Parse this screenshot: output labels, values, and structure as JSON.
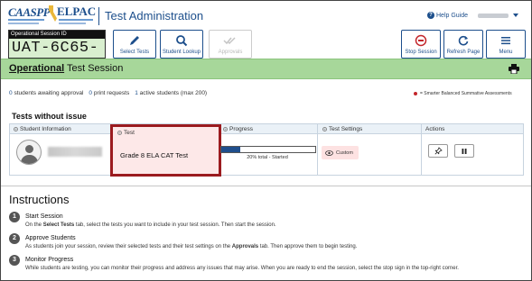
{
  "header": {
    "logo_caaspp": "CAASPP",
    "logo_elpac": "ELPAC",
    "title": "Test Administration",
    "help_label": "Help Guide"
  },
  "session": {
    "id_label": "Operational Session ID",
    "id_value": "UAT-6C65-3T"
  },
  "toolbar": {
    "select_tests": "Select Tests",
    "student_lookup": "Student Lookup",
    "approvals": "Approvals",
    "stop_session": "Stop Session",
    "refresh_page": "Refresh Page",
    "menu": "Menu"
  },
  "page_title": {
    "underlined": "Operational",
    "rest": " Test Session"
  },
  "stats": {
    "awaiting_count": "0",
    "awaiting_label": "students awaiting approval",
    "print_count": "0",
    "print_label": "print requests",
    "active_count": "1",
    "active_label": "active students (max 200)",
    "legend": "= Smarter Balanced Summative Assessments",
    "legend_color": "#c3262b"
  },
  "table": {
    "section_title": "Tests without issue",
    "columns": [
      "Student Information",
      "Test",
      "Progress",
      "Test Settings",
      "Actions"
    ],
    "rows": [
      {
        "test": "Grade 8 ELA CAT Test",
        "progress_pct": 20,
        "progress_text": "20% total  -  Started",
        "settings": "Custom"
      }
    ]
  },
  "instructions": {
    "title": "Instructions",
    "steps": [
      {
        "num": "1",
        "heading": "Start Session",
        "desc_a": "On the ",
        "desc_bold": "Select Tests",
        "desc_b": " tab, select the tests you want to include in your test session. Then start the session."
      },
      {
        "num": "2",
        "heading": "Approve Students",
        "desc_a": "As students join your session, review their selected tests and their test settings on the ",
        "desc_bold": "Approvals",
        "desc_b": " tab. Then approve them to begin testing."
      },
      {
        "num": "3",
        "heading": "Monitor Progress",
        "desc_a": "While students are testing, you can monitor their progress and address any issues that may arise. When you are ready to end the session, select the stop sign in the top-right corner.",
        "desc_bold": "",
        "desc_b": ""
      }
    ]
  },
  "colors": {
    "brand": "#1d4f8c",
    "green_bar": "#a7d79a",
    "highlight_border": "#9b1b1f"
  }
}
